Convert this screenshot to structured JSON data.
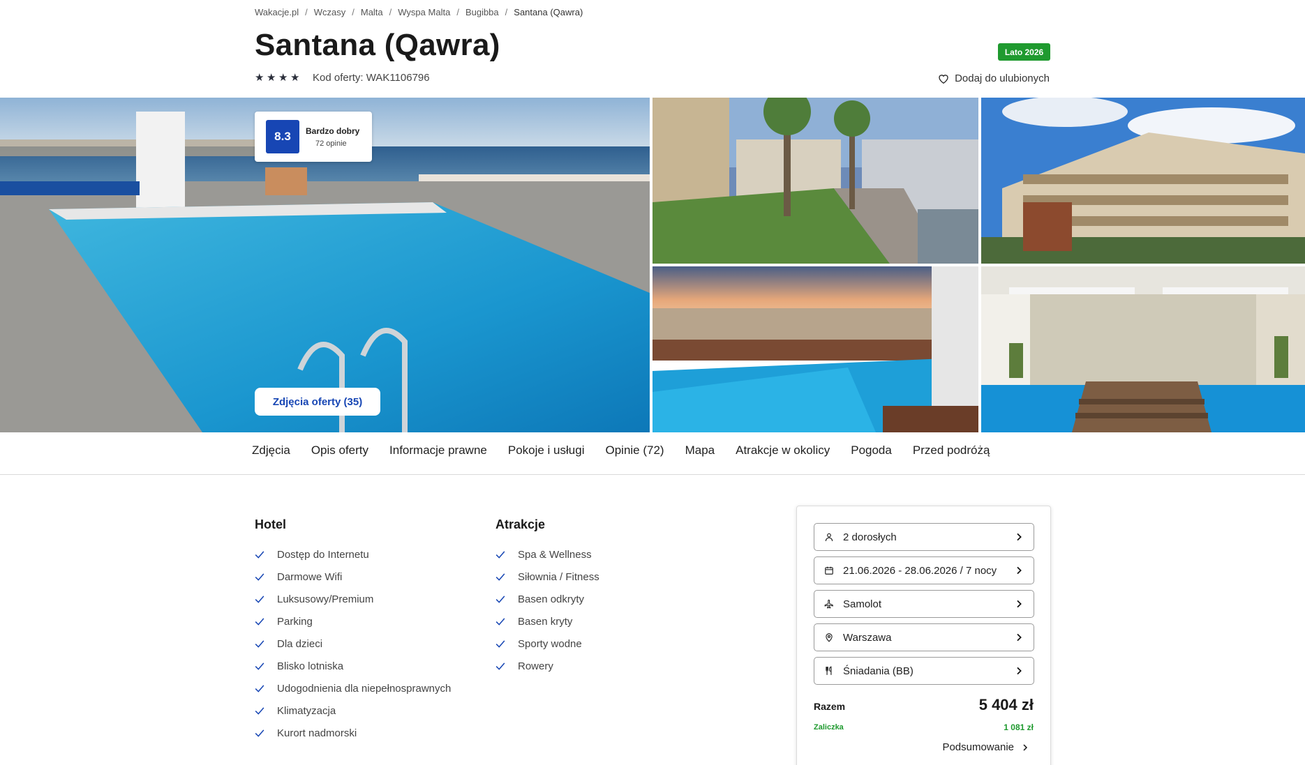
{
  "breadcrumb": [
    "Wakacje.pl",
    "Wczasy",
    "Malta",
    "Wyspa Malta",
    "Bugibba",
    "Santana (Qawra)"
  ],
  "title": "Santana (Qawra)",
  "season_badge": "Lato 2026",
  "stars": 4,
  "offer_code": "Kod oferty: WAK1106796",
  "favorite_label": "Dodaj do ulubionych",
  "rating": {
    "score": "8.3",
    "label": "Bardzo dobry",
    "reviews": "72 opinie"
  },
  "photos_button": "Zdjęcia oferty (35)",
  "tabs": [
    "Zdjęcia",
    "Opis oferty",
    "Informacje prawne",
    "Pokoje i usługi",
    "Opinie (72)",
    "Mapa",
    "Atrakcje w okolicy",
    "Pogoda",
    "Przed podróżą"
  ],
  "amenities": {
    "hotel_title": "Hotel",
    "hotel": [
      "Dostęp do Internetu",
      "Darmowe Wifi",
      "Luksusowy/Premium",
      "Parking",
      "Dla dzieci",
      "Blisko lotniska",
      "Udogodnienia dla niepełnosprawnych",
      "Klimatyzacja",
      "Kurort nadmorski"
    ],
    "attractions_title": "Atrakcje",
    "attractions": [
      "Spa & Wellness",
      "Siłownia / Fitness",
      "Basen odkryty",
      "Basen kryty",
      "Sporty wodne",
      "Rowery"
    ]
  },
  "booking": {
    "travelers": "2 dorosłych",
    "dates": "21.06.2026 - 28.06.2026 / 7 nocy",
    "transport": "Samolot",
    "departure": "Warszawa",
    "board": "Śniadania (BB)",
    "total_label": "Razem",
    "total_price": "5 404 zł",
    "deposit_label": "Zaliczka",
    "deposit_price": "1 081 zł",
    "summary_label": "Podsumowanie"
  },
  "colors": {
    "brand_blue": "#1746b4",
    "badge_green": "#1f9a2f"
  }
}
